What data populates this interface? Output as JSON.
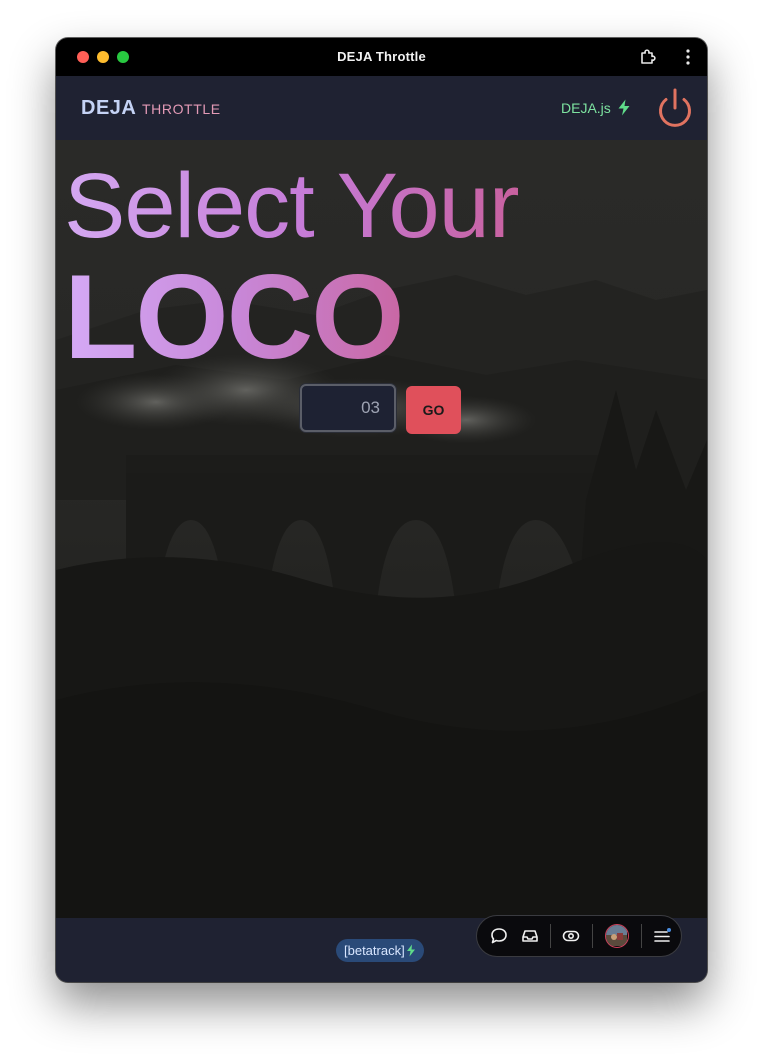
{
  "window": {
    "title": "DEJA Throttle"
  },
  "header": {
    "brand": "DEJA",
    "subtitle": "THROTTLE",
    "link_label": "DEJA.js",
    "icons": [
      "lightning-icon",
      "power-icon"
    ]
  },
  "hero": {
    "title_line1": "Select Your",
    "title_line2": "LOCO"
  },
  "loco_form": {
    "input_value": "03",
    "submit_label": "GO"
  },
  "footer": {
    "layout_chip": "[betatrack]",
    "dock_icons": [
      "chat-icon",
      "inbox-icon",
      "eye-icon",
      "avatar",
      "menu-icon"
    ]
  },
  "colors": {
    "accent_red": "#e0505b",
    "brand_green": "#7de3a0",
    "title_gradient_start": "#d4a8f2",
    "title_gradient_end": "#c8619f",
    "power_color": "#e07360"
  }
}
